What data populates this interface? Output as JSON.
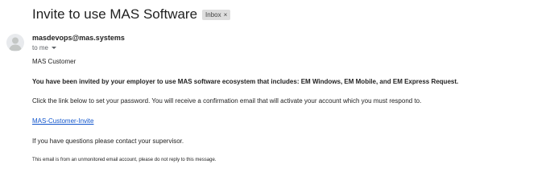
{
  "email": {
    "subject": "Invite to use MAS Software",
    "label": "Inbox",
    "label_close": "×",
    "sender": "masdevops@mas.systems",
    "to_line": "to me",
    "greeting": "MAS Customer",
    "invite_line": "You have been invited by your employer to use MAS software ecosystem that includes: EM Windows, EM Mobile, and EM Express Request.",
    "instructions": "Click the link below to set your password. You will receive a confirmation email that will activate your account which you must respond to.",
    "link_text": "MAS-Customer-Invite",
    "questions": "If you have questions please contact your supervisor.",
    "footer_note": "This email is from an unmonitored email account, please do not reply to this message."
  },
  "icons": {
    "avatar": "person-avatar-icon",
    "recipient_toggle": "chevron-down-icon",
    "label_remove": "close-icon"
  }
}
